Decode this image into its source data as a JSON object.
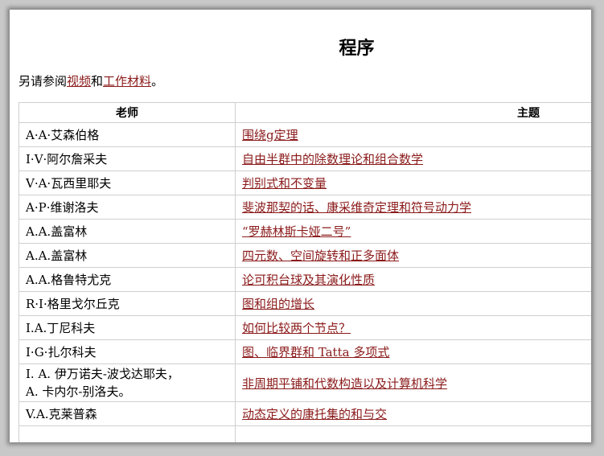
{
  "page": {
    "title": "程序",
    "see_also": {
      "prefix": "另请参阅",
      "link1": "视频",
      "middle": "和",
      "link2": "工作材料",
      "suffix": "。"
    }
  },
  "table": {
    "headers": {
      "teacher": "老师",
      "topic": "主题"
    },
    "rows": [
      {
        "teacher": "A·A·艾森伯格",
        "topic": "围绕g定理"
      },
      {
        "teacher": "I·V·阿尔詹采夫",
        "topic": "自由半群中的除数理论和组合数学"
      },
      {
        "teacher": "V·A·瓦西里耶夫",
        "topic": "判别式和不变量"
      },
      {
        "teacher": "A·P·维谢洛夫",
        "topic": "斐波那契的话、康采维奇定理和符号动力学"
      },
      {
        "teacher": "A.A.盖富林",
        "topic": "“罗赫林斯卡娅二号”"
      },
      {
        "teacher": "A.A.盖富林",
        "topic": "四元数、空间旋转和正多面体"
      },
      {
        "teacher": "A.A.格鲁特尤克",
        "topic": "论可积台球及其演化性质"
      },
      {
        "teacher": "R·I·格里戈尔丘克",
        "topic": "图和组的增长"
      },
      {
        "teacher": "I.A.丁尼科夫",
        "topic": "如何比较两个节点？"
      },
      {
        "teacher": "I·G·扎尔科夫",
        "topic": "图、临界群和 Tatta 多项式"
      },
      {
        "teacher_line1": "I. A. 伊万诺夫-波戈达耶夫，",
        "teacher_line2": "A. 卡内尔-别洛夫。",
        "topic": "非周期平铺和代数构造以及计算机科学"
      },
      {
        "teacher": "V.A.克莱普森",
        "topic": "动态定义的康托集的和与交"
      }
    ]
  }
}
